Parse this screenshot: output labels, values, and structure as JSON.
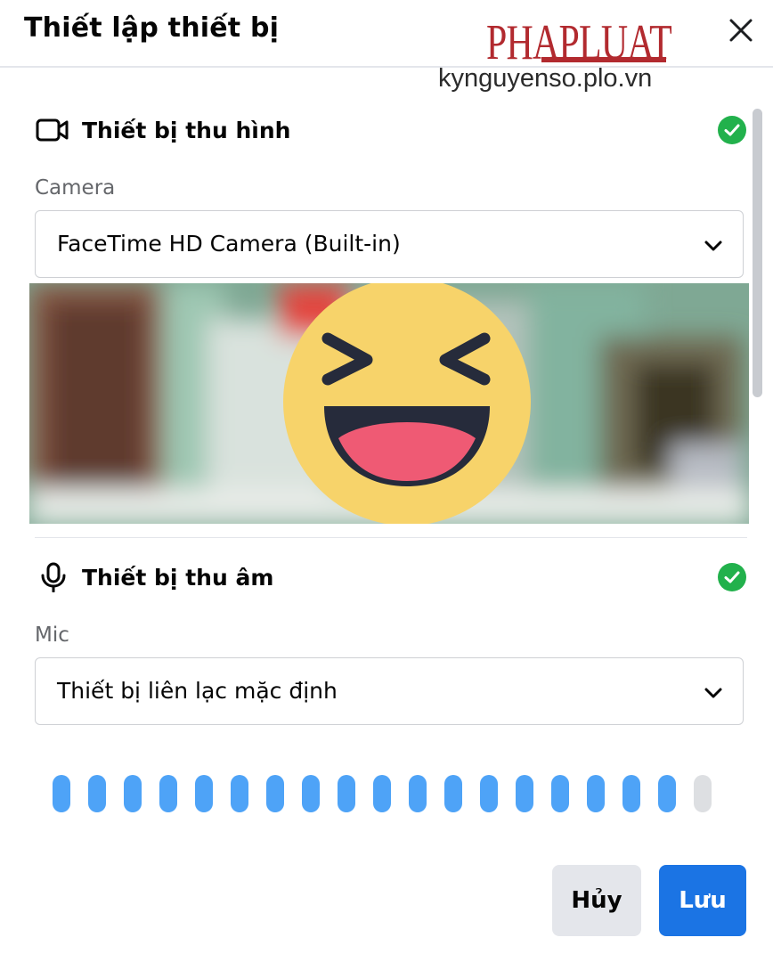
{
  "dialog": {
    "title": "Thiết lập thiết bị",
    "close_icon": "close-icon"
  },
  "watermark": {
    "logo_text": "PHAPLUAT",
    "site": "kynguyenso.plo.vn"
  },
  "video_section": {
    "heading": "Thiết bị thu hình",
    "icon": "video-camera-icon",
    "status": "ok",
    "field_label": "Camera",
    "selected": "FaceTime HD Camera (Built-in)"
  },
  "audio_section": {
    "heading": "Thiết bị thu âm",
    "icon": "microphone-icon",
    "status": "ok",
    "field_label": "Mic",
    "selected": "Thiết bị liên lạc mặc định"
  },
  "mic_level": {
    "total_segments": 19,
    "active_segments": 18
  },
  "buttons": {
    "cancel": "Hủy",
    "save": "Lưu"
  },
  "colors": {
    "accent": "#1b74e4",
    "success": "#22b14c",
    "meter_active": "#4ea3f7",
    "meter_inactive": "#dddfe2"
  }
}
